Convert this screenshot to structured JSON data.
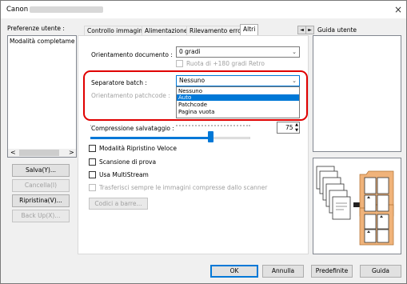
{
  "window": {
    "title": "Canon",
    "close_glyph": "×"
  },
  "left": {
    "prefs_label": "Preferenze utente :",
    "list_items": [
      "Modalità completamente"
    ],
    "scroll_left": "<",
    "scroll_right": ">",
    "save_label": "Salva(Y)...",
    "delete_label": "Cancella(I)",
    "restore_label": "Ripristina(V)...",
    "backup_label": "Back Up(X)..."
  },
  "tabs": {
    "items": [
      "Controllo immagine",
      "Alimentazione",
      "Rilevamento errori",
      "Altri"
    ],
    "active_index": 3,
    "nav_left": "◄",
    "nav_right": "►"
  },
  "guide": {
    "title": "Guida utente"
  },
  "panel": {
    "orientation_label": "Orientamento documento :",
    "orientation_value": "0 gradi",
    "rotate_label": "Ruota di +180 gradi Retro",
    "separator_label": "Separatore batch :",
    "separator_value": "Nessuno",
    "separator_options": [
      "Nessuno",
      "Auto",
      "Patchcode",
      "Pagina vuota"
    ],
    "separator_selected_index": 1,
    "patch_orientation_label": "Orientamento patchcode :",
    "compression_label": "Compressione salvataggio :",
    "compression_value": "75",
    "compression_fraction": 0.75,
    "checkboxes": [
      {
        "label": "Modalità Ripristino Veloce",
        "disabled": false
      },
      {
        "label": "Scansione di prova",
        "disabled": false
      },
      {
        "label": "Usa MultiStream",
        "disabled": false
      },
      {
        "label": "Trasferisci sempre le immagini compresse dallo scanner",
        "disabled": true
      }
    ],
    "barcode_button": "Codici a barre..."
  },
  "footer": {
    "ok_label": "OK",
    "cancel_label": "Annulla",
    "default_label": "Predefinite",
    "help_label": "Guida"
  },
  "colors": {
    "accent": "#0078d7",
    "highlight_box": "#e00000",
    "folder": "#f0b37a"
  }
}
